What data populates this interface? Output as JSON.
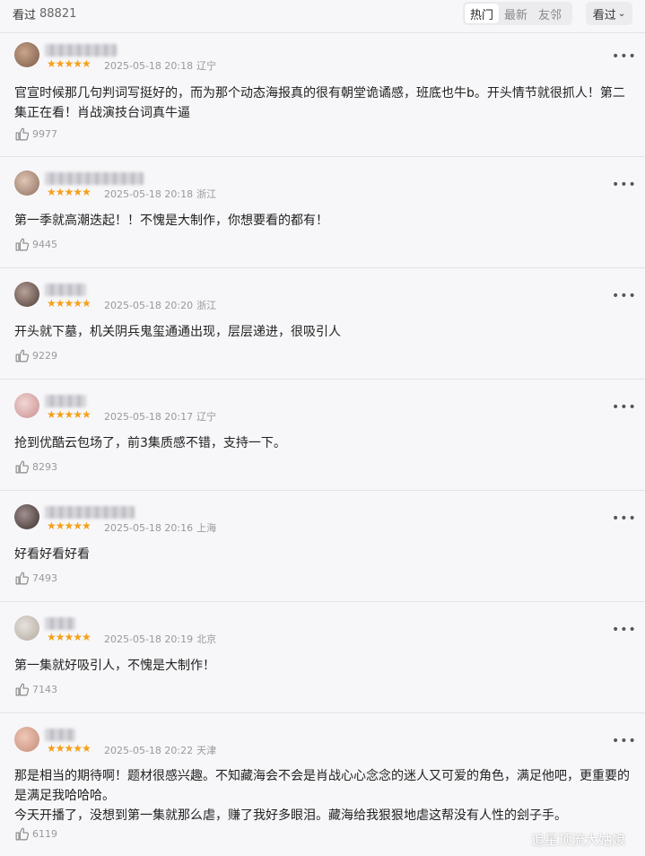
{
  "header": {
    "title": "看过",
    "count": "88821",
    "tabs": [
      {
        "label": "热门",
        "active": true
      },
      {
        "label": "最新",
        "active": false
      },
      {
        "label": "友邻",
        "active": false
      }
    ],
    "sort_label": "看过"
  },
  "comments": [
    {
      "stars": "★★★★★",
      "time": "2025-05-18 20:18",
      "location": "辽宁",
      "text": "官宣时候那几句判词写挺好的，而为那个动态海报真的很有朝堂诡谲感，班底也牛b。开头情节就很抓人！第二集正在看！肖战演技台词真牛逼",
      "likes": "9977"
    },
    {
      "stars": "★★★★★",
      "time": "2025-05-18 20:18",
      "location": "浙江",
      "text": "第一季就高潮迭起！！不愧是大制作，你想要看的都有！",
      "likes": "9445"
    },
    {
      "stars": "★★★★★",
      "time": "2025-05-18 20:20",
      "location": "浙江",
      "text": "开头就下墓，机关阴兵鬼玺通通出现，层层递进，很吸引人",
      "likes": "9229"
    },
    {
      "stars": "★★★★★",
      "time": "2025-05-18 20:17",
      "location": "辽宁",
      "text": "抢到优酷云包场了，前3集质感不错，支持一下。",
      "likes": "8293"
    },
    {
      "stars": "★★★★★",
      "time": "2025-05-18 20:16",
      "location": "上海",
      "text": "好看好看好看",
      "likes": "7493"
    },
    {
      "stars": "★★★★★",
      "time": "2025-05-18 20:19",
      "location": "北京",
      "text": "第一集就好吸引人，不愧是大制作！",
      "likes": "7143"
    },
    {
      "stars": "★★★★★",
      "time": "2025-05-18 20:22",
      "location": "天津",
      "text": "那是相当的期待啊！题材很感兴趣。不知藏海会不会是肖战心心念念的迷人又可爱的角色，满足他吧，更重要的是满足我哈哈哈。\n今天开播了，没想到第一集就那么虐，赚了我好多眼泪。藏海给我狠狠地虐这帮没有人性的刽子手。",
      "likes": "6119"
    }
  ],
  "icons": {
    "like": "thumbs-up-icon",
    "more": "more-dots-icon",
    "sort": "chevron-down-icon"
  },
  "colors": {
    "star": "#f5a01a",
    "meta": "#999999"
  },
  "watermark": "追星顶流大姑娘"
}
